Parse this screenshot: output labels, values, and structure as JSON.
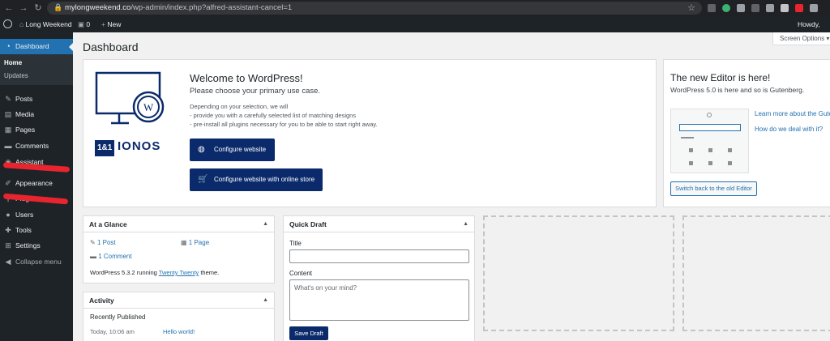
{
  "browser": {
    "url_domain": "mylongweekend.co",
    "url_path": "/wp-admin/index.php?alfred-assistant-cancel=1",
    "back_icon": "←",
    "forward_icon": "→",
    "reload_icon": "↻",
    "star_icon": "☆",
    "lock_icon": "🔒"
  },
  "adminbar": {
    "site_name": "Long Weekend",
    "comments_count": "0",
    "new_label": "New",
    "howdy": "Howdy,"
  },
  "sidebar": {
    "dashboard": "Dashboard",
    "home": "Home",
    "updates": "Updates",
    "posts": "Posts",
    "media": "Media",
    "pages": "Pages",
    "comments": "Comments",
    "assistant": "Assistant",
    "appearance": "Appearance",
    "plugins": "Plugins",
    "users": "Users",
    "tools": "Tools",
    "settings": "Settings",
    "collapse": "Collapse menu"
  },
  "main": {
    "screen_options": "Screen Options ▾",
    "page_title": "Dashboard",
    "welcome": {
      "brand": "1&1 IONOS",
      "brand_part1": "1&1",
      "brand_part2": "IONOS",
      "title": "Welcome to WordPress!",
      "subtitle": "Please choose your primary use case.",
      "desc_1": "Depending on your selection, we will",
      "desc_2": "- provide you with a carefully selected list of matching designs",
      "desc_3": "- pre-install all plugins necessary for you to be able to start right away.",
      "btn_website": "Configure website",
      "btn_store": "Configure website with online store"
    },
    "editor": {
      "title": "The new Editor is here!",
      "subtitle": "WordPress 5.0 is here and so is Gutenberg.",
      "link_1": "Learn more about the Gute",
      "link_2": "How do we deal with it?",
      "switch_btn": "Switch back to the old Editor"
    },
    "at_a_glance": {
      "title": "At a Glance",
      "posts": "1 Post",
      "pages": "1 Page",
      "comments": "1 Comment",
      "version_prefix": "WordPress 5.3.2 running ",
      "theme_link": "Twenty Twenty",
      "version_suffix": " theme."
    },
    "activity": {
      "title": "Activity",
      "recently_published": "Recently Published",
      "date": "Today, 10:06 am",
      "post_link": "Hello world!"
    },
    "quick_draft": {
      "title": "Quick Draft",
      "title_label": "Title",
      "content_label": "Content",
      "content_placeholder": "What's on your mind?",
      "save_btn": "Save Draft"
    },
    "toggle_icon": "▲"
  },
  "colors": {
    "accent": "#2271b1",
    "ionos": "#0b2a6b",
    "sidebar": "#1d2327"
  }
}
